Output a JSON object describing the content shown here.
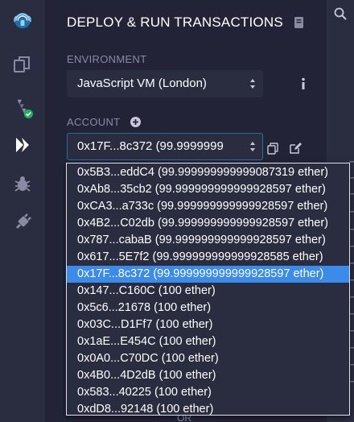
{
  "rail": {
    "icons": [
      "remix-logo-icon",
      "file-explorer-icon",
      "solidity-compiler-icon",
      "deploy-run-icon",
      "debugger-icon",
      "plugin-manager-icon"
    ]
  },
  "panel": {
    "title": "DEPLOY & RUN TRANSACTIONS",
    "environment": {
      "label": "ENVIRONMENT",
      "value": "JavaScript VM (London)"
    },
    "account": {
      "label": "ACCOUNT",
      "value": "0x17F...8c372 (99.9999999",
      "options": [
        "0x5B3...eddC4 (99.999999999999087319 ether)",
        "0xAb8...35cb2 (99.999999999999928597 ether)",
        "0xCA3...a733c (99.999999999999928597 ether)",
        "0x4B2...C02db (99.999999999999928597 ether)",
        "0x787...cabaB (99.999999999999928597 ether)",
        "0x617...5E7f2 (99.999999999999928585 ether)",
        "0x17F...8c372 (99.999999999999928597 ether)",
        "0x147...C160C (100 ether)",
        "0x5c6...21678 (100 ether)",
        "0x03C...D1Ff7 (100 ether)",
        "0x1aE...E454C (100 ether)",
        "0x0A0...C70DC (100 ether)",
        "0x4B0...4D2dB (100 ether)",
        "0x583...40225 (100 ether)",
        "0xdD8...92148 (100 ether)"
      ],
      "selected_index": 6
    },
    "partial_text": "OR"
  },
  "colors": {
    "rail_bg": "#2a2c3f",
    "panel_bg": "#222336",
    "accent": "#3b8beb",
    "success": "#1fb05e",
    "text_muted": "#8a8ba3"
  }
}
